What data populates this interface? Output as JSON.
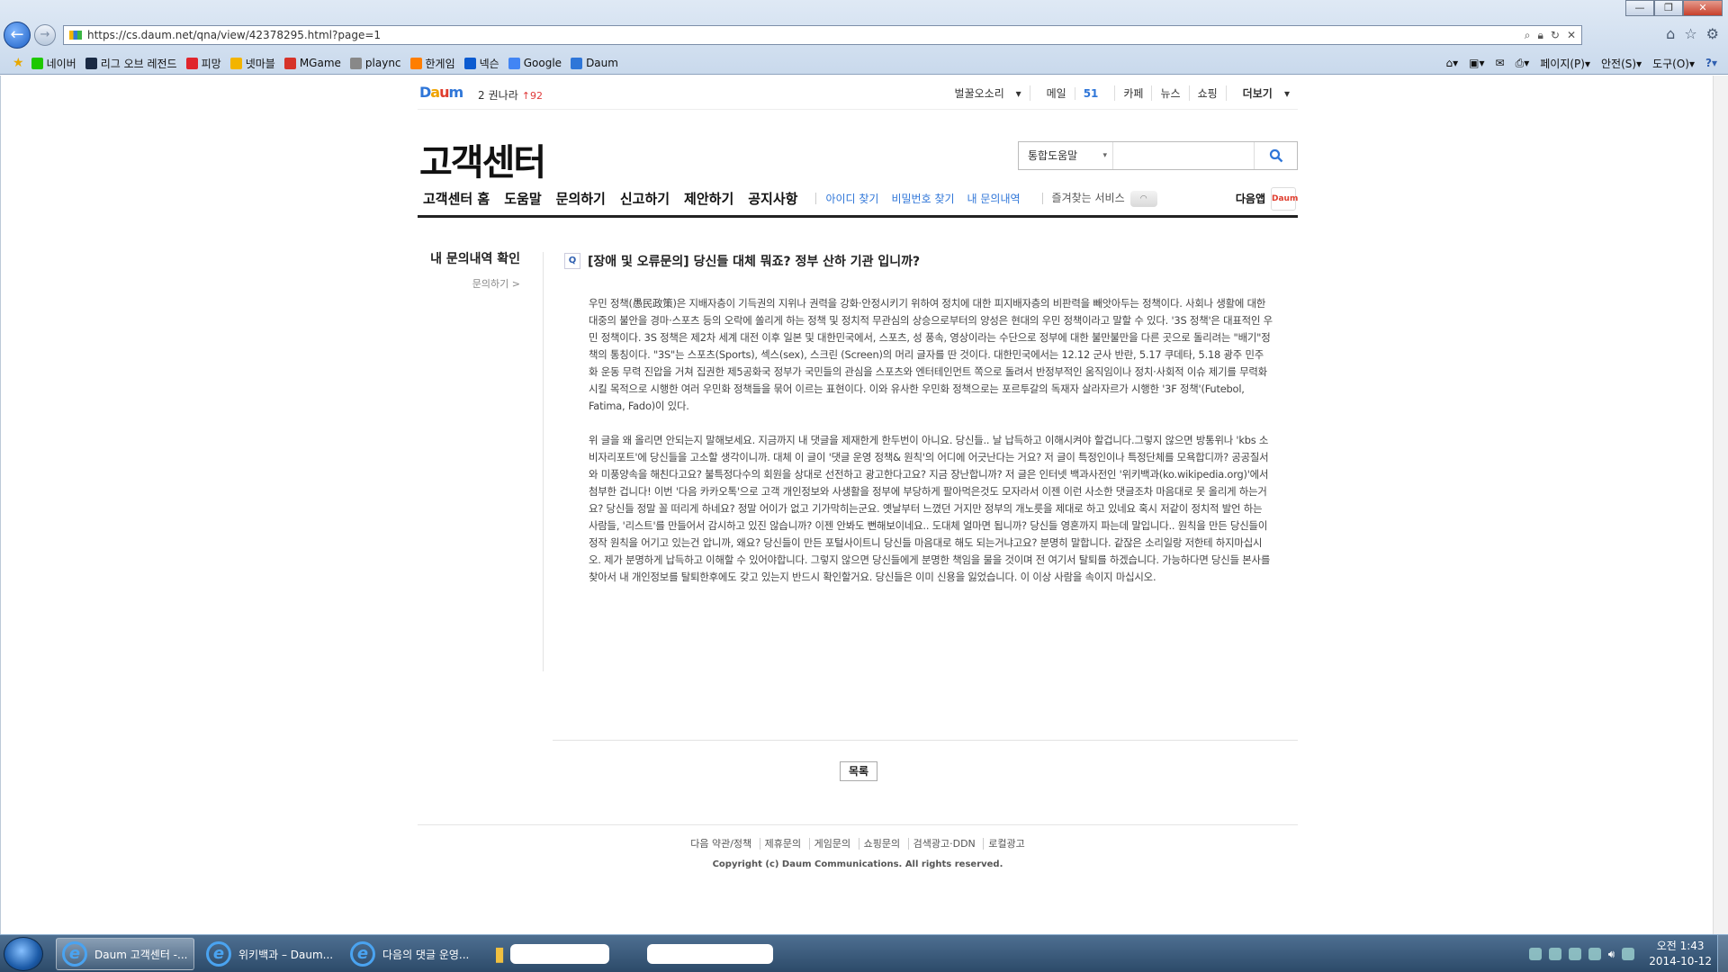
{
  "browser": {
    "url": "https://cs.daum.net/qna/view/42378295.html?page=1",
    "window_buttons": {
      "minimize": "—",
      "maximize": "❐",
      "close": "✕"
    },
    "favorites": [
      "네이버",
      "리그 오브 레전드",
      "피망",
      "넷마블",
      "MGame",
      "plaync",
      "한게임",
      "넥슨",
      "Google",
      "Daum"
    ],
    "favorite_colors": [
      "#1ec800",
      "#1a2a44",
      "#e0252c",
      "#f3b400",
      "#d6332a",
      "#888888",
      "#ff7e00",
      "#0b5bd0",
      "#4285f4",
      "#2f76d8"
    ],
    "commands": [
      "페이지(P)",
      "안전(S)",
      "도구(O)"
    ]
  },
  "daum_top": {
    "logo": [
      "D",
      "a",
      "u",
      "m"
    ],
    "rank_no": "2",
    "rank_word": "권나라",
    "rank_change": "↑92",
    "gnb": {
      "sound": "벌꿀오소리",
      "mail": "메일",
      "mail_count": "51",
      "cafe": "카페",
      "news": "뉴스",
      "shopping": "쇼핑",
      "more": "더보기"
    }
  },
  "header": {
    "title": "고객센터",
    "search_scope": "통합도움말",
    "search_value": ""
  },
  "menu": {
    "main": [
      "고객센터 홈",
      "도움말",
      "문의하기",
      "신고하기",
      "제안하기",
      "공지사항"
    ],
    "sub": [
      "아이디 찾기",
      "비밀번호 찾기",
      "내 문의내역"
    ],
    "fav": "즐겨찾는 서비스",
    "app": "다음앱",
    "app_badge": "Daum"
  },
  "lnb": {
    "heading": "내 문의내역 확인",
    "link": "문의하기 >"
  },
  "question": {
    "badge": "Q",
    "title": "[장애 및 오류문의] 당신들 대체 뭐죠? 정부 산하 기관 입니까?",
    "paragraphs": [
      "우민 정책(愚民政策)은 지배자층이 기득권의 지위나 권력을 강화·안정시키기 위하여 정치에 대한 피지배자층의 비판력을 빼앗아두는 정책이다. 사회나 생활에 대한 대중의 불안을 경마·스포츠 등의 오락에 쏠리게 하는 정책 및 정치적 무관심의 상승으로부터의 양성은 현대의 우민 정책이라고 말할 수 있다. '3S 정책'은 대표적인 우민 정책이다. 3S 정책은 제2차 세계 대전 이후 일본 및 대한민국에서, 스포츠, 성 풍속, 영상이라는 수단으로 정부에 대한 불만불만을 다른 곳으로 돌리려는 \"배기\"정책의 통칭이다. \"3S\"는 스포츠(Sports), 섹스(sex), 스크린 (Screen)의 머리 글자를 딴 것이다. 대한민국에서는 12.12 군사 반란, 5.17 쿠데타, 5.18 광주 민주화 운동 무력 진압을 거쳐 집권한 제5공화국 정부가 국민들의 관심을 스포츠와 엔터테인먼트 쪽으로 돌려서 반정부적인 움직임이나 정치·사회적 이슈 제기를 무력화시킬 목적으로 시행한 여러 우민화 정책들을 묶어 이르는 표현이다. 이와 유사한 우민화 정책으로는 포르투갈의 독재자 살라자르가 시행한 '3F 정책'(Futebol, Fatima, Fado)이 있다.",
      "위 글을 왜 올리면 안되는지 말해보세요. 지금까지 내 댓글을 제재한게 한두번이 아니요. 당신들.. 날 납득하고 이해시켜야 할겁니다.그렇지 않으면 방통위나 'kbs 소비자리포트'에 당신들을 고소할 생각이니까. 대체 이 글이 '댓글 운영 정책& 원칙'의 어디에 어긋난다는 거요? 저 글이 특정인이나 특정단체를 모욕합디까? 공공질서와 미풍양속을 해친다고요? 불특정다수의 회원을 상대로 선전하고 광고한다고요? 지금 장난합니까? 저 글은 인터넷 백과사전인 '위키백과(ko.wikipedia.org)'에서 첨부한 겁니다! 이번 '다음 카카오톡'으로 고객 개인정보와 사생활을 정부에 부당하게 팔아먹은것도 모자라서 이젠 이런 사소한 댓글조차 마음대로 못 올리게 하는거요? 당신들 정말 꼴 떠리게 하네요? 정말 어이가 없고 기가막히는군요. 옛날부터 느꼈던 거지만 정부의 개노릇을 제대로 하고 있네요 혹시 저같이 정치적 발언 하는 사람들, '리스트'를 만들어서 감시하고 있진 않습니까? 이젠 안봐도 뻔해보이네요.. 도대체 얼마면 됩니까? 당신들 영혼까지 파는데 말입니다.. 원칙을 만든 당신들이 정작 원칙을 어기고 있는건 압니까, 왜요? 당신들이 만든 포털사이트니 당신들 마음대로 해도 되는거냐고요? 분명히 말합니다. 같잖은 소리일랑 저한테 하지마십시오. 제가 분명하게 납득하고 이해할 수 있어야합니다. 그렇지 않으면 당신들에게 분명한 책임을 물을 것이며 전 여기서 탈퇴를 하겠습니다. 가능하다면 당신들 본사를 찾아서 내 개인정보를 탈퇴한후에도 갖고 있는지 반드시 확인할거요. 당신들은 이미 신용을 잃었습니다. 이 이상 사람을 속이지 마십시오."
    ],
    "list_button": "목록"
  },
  "footer": {
    "links": [
      "다음 약관/정책",
      "제휴문의",
      "게임문의",
      "쇼핑문의",
      "검색광고·DDN",
      "로컬광고"
    ],
    "copyright": "Copyright (c) Daum Communications. All rights reserved."
  },
  "taskbar": {
    "tasks": [
      "Daum 고객센터 -...",
      "위키백과 – Daum...",
      "다음의 댓글 운영..."
    ],
    "clock_period_time": "오전 1:43",
    "clock_date": "2014-10-12"
  }
}
